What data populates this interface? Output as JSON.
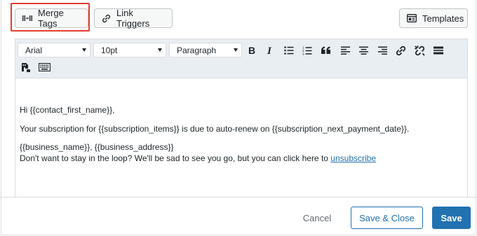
{
  "topbar": {
    "merge_tags_label": "Merge Tags",
    "link_triggers_label": "Link Triggers",
    "templates_label": "Templates"
  },
  "toolbar": {
    "font_family": "Arial",
    "font_size": "10pt",
    "block_format": "Paragraph",
    "tools": [
      "bold-icon",
      "italic-icon",
      "bullet-list-icon",
      "numbered-list-icon",
      "blockquote-icon",
      "align-left-icon",
      "align-center-icon",
      "align-right-icon",
      "link-icon",
      "unlink-icon",
      "horizontal-rule-icon",
      "merge-tag-insert-icon",
      "keyboard-icon"
    ]
  },
  "content": {
    "greeting": "Hi {{contact_first_name}},",
    "body": "Your subscription for {{subscription_items}} is due to auto-renew on {{subscription_next_payment_date}}.",
    "address": "{{business_name}}, {{business_address}}",
    "unsubscribe_text": "Don't want to stay in the loop? We'll be sad to see you go, but you can click here to ",
    "unsubscribe_link": "unsubscribe"
  },
  "footer": {
    "cancel_label": "Cancel",
    "save_close_label": "Save & Close",
    "save_label": "Save"
  },
  "colors": {
    "primary": "#2271b1",
    "highlight": "#e43d30",
    "toolbar_bg": "#e9eef3"
  }
}
